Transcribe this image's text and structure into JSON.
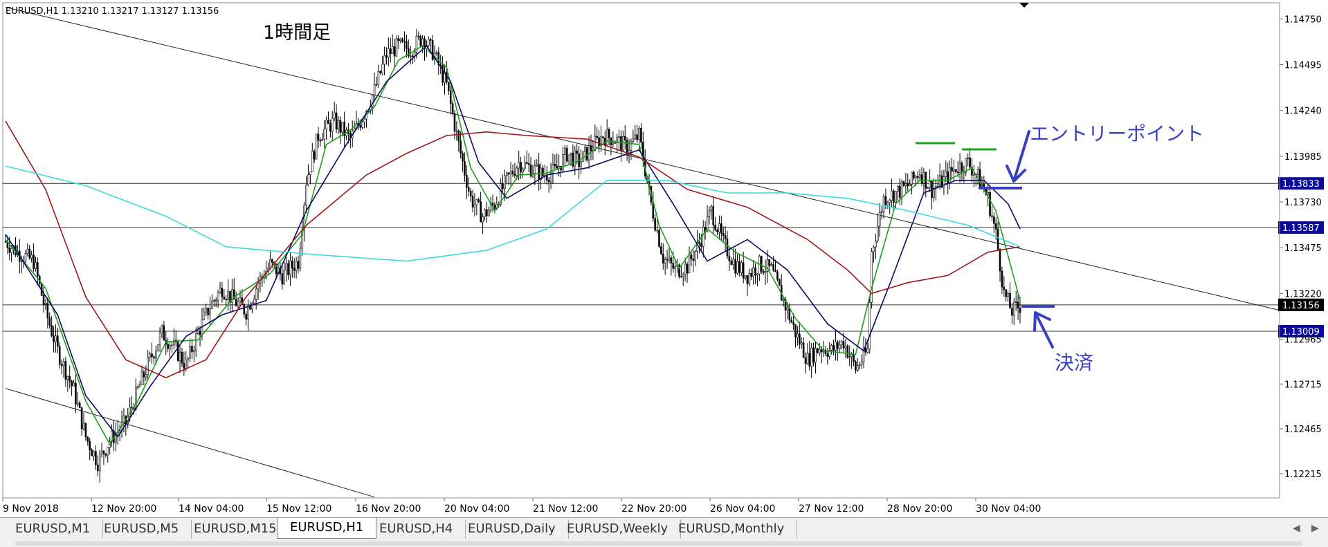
{
  "chart_data": {
    "type": "candlestick",
    "symbol_header": "EURUSD,H1  1.13210 1.13217 1.13127 1.13156",
    "title": "1時間足",
    "ylim": [
      1.1208,
      1.1484
    ],
    "y_ticks": [
      "1.14750",
      "1.14495",
      "1.14240",
      "1.13985",
      "1.13730",
      "1.13475",
      "1.13220",
      "1.12965",
      "1.12715",
      "1.12465",
      "1.12215"
    ],
    "x_tick_labels": [
      "9 Nov 2018",
      "12 Nov 20:00",
      "14 Nov 04:00",
      "15 Nov 12:00",
      "16 Nov 20:00",
      "20 Nov 04:00",
      "21 Nov 12:00",
      "22 Nov 20:00",
      "26 Nov 04:00",
      "27 Nov 12:00",
      "28 Nov 20:00",
      "30 Nov 04:00"
    ],
    "horizontal_levels": [
      {
        "value": 1.13833,
        "label": "1.13833",
        "color": "#0a0a9a"
      },
      {
        "value": 1.13587,
        "label": "1.13587",
        "color": "#0a0a9a"
      },
      {
        "value": 1.13156,
        "label": "1.13156",
        "color": "#000000"
      },
      {
        "value": 1.13009,
        "label": "1.13009",
        "color": "#0a0a9a"
      }
    ],
    "current_price": "1.13156",
    "close_path": [
      [
        0,
        1.1351
      ],
      [
        6,
        1.1345
      ],
      [
        14,
        1.134
      ],
      [
        20,
        1.1312
      ],
      [
        26,
        1.129
      ],
      [
        34,
        1.1268
      ],
      [
        40,
        1.1242
      ],
      [
        46,
        1.1228
      ],
      [
        52,
        1.124
      ],
      [
        60,
        1.125
      ],
      [
        66,
        1.1268
      ],
      [
        72,
        1.1285
      ],
      [
        78,
        1.13
      ],
      [
        84,
        1.1292
      ],
      [
        90,
        1.1282
      ],
      [
        96,
        1.13
      ],
      [
        102,
        1.1315
      ],
      [
        108,
        1.1325
      ],
      [
        114,
        1.1318
      ],
      [
        120,
        1.1312
      ],
      [
        126,
        1.1328
      ],
      [
        132,
        1.1338
      ],
      [
        138,
        1.1332
      ],
      [
        146,
        1.134
      ],
      [
        150,
        1.1385
      ],
      [
        156,
        1.141
      ],
      [
        164,
        1.1418
      ],
      [
        172,
        1.1408
      ],
      [
        178,
        1.142
      ],
      [
        184,
        1.1435
      ],
      [
        190,
        1.1455
      ],
      [
        196,
        1.146
      ],
      [
        202,
        1.1458
      ],
      [
        208,
        1.1465
      ],
      [
        214,
        1.1455
      ],
      [
        220,
        1.1438
      ],
      [
        226,
        1.1405
      ],
      [
        232,
        1.1375
      ],
      [
        238,
        1.1365
      ],
      [
        244,
        1.1372
      ],
      [
        250,
        1.1385
      ],
      [
        256,
        1.1395
      ],
      [
        262,
        1.1392
      ],
      [
        268,
        1.1388
      ],
      [
        274,
        1.139
      ],
      [
        280,
        1.14
      ],
      [
        286,
        1.1395
      ],
      [
        292,
        1.1403
      ],
      [
        298,
        1.141
      ],
      [
        304,
        1.1408
      ],
      [
        310,
        1.1403
      ],
      [
        316,
        1.141
      ],
      [
        322,
        1.1372
      ],
      [
        328,
        1.1342
      ],
      [
        334,
        1.1335
      ],
      [
        340,
        1.1337
      ],
      [
        346,
        1.135
      ],
      [
        352,
        1.1368
      ],
      [
        358,
        1.135
      ],
      [
        364,
        1.1338
      ],
      [
        370,
        1.1332
      ],
      [
        376,
        1.1338
      ],
      [
        382,
        1.1335
      ],
      [
        388,
        1.1318
      ],
      [
        394,
        1.13
      ],
      [
        400,
        1.1285
      ],
      [
        406,
        1.1292
      ],
      [
        412,
        1.129
      ],
      [
        418,
        1.1295
      ],
      [
        424,
        1.128
      ],
      [
        430,
        1.129
      ],
      [
        432,
        1.1345
      ],
      [
        438,
        1.1375
      ],
      [
        444,
        1.1378
      ],
      [
        450,
        1.1382
      ],
      [
        456,
        1.139
      ],
      [
        462,
        1.138
      ],
      [
        468,
        1.1385
      ],
      [
        474,
        1.1392
      ],
      [
        480,
        1.1395
      ],
      [
        486,
        1.1385
      ],
      [
        490,
        1.1375
      ],
      [
        494,
        1.1355
      ],
      [
        498,
        1.1322
      ],
      [
        502,
        1.1312
      ],
      [
        506,
        1.1315
      ]
    ],
    "series": [
      {
        "name": "",
        "color": "#1aa01a",
        "values": [
          [
            0,
            1.1352
          ],
          [
            20,
            1.1325
          ],
          [
            40,
            1.1262
          ],
          [
            52,
            1.1238
          ],
          [
            66,
            1.1262
          ],
          [
            80,
            1.1295
          ],
          [
            96,
            1.1296
          ],
          [
            114,
            1.132
          ],
          [
            132,
            1.1333
          ],
          [
            148,
            1.1355
          ],
          [
            160,
            1.1405
          ],
          [
            172,
            1.1413
          ],
          [
            184,
            1.1426
          ],
          [
            196,
            1.1452
          ],
          [
            208,
            1.146
          ],
          [
            220,
            1.1448
          ],
          [
            232,
            1.1392
          ],
          [
            244,
            1.1368
          ],
          [
            256,
            1.1388
          ],
          [
            270,
            1.1389
          ],
          [
            286,
            1.1396
          ],
          [
            300,
            1.1407
          ],
          [
            316,
            1.1405
          ],
          [
            326,
            1.136
          ],
          [
            336,
            1.1336
          ],
          [
            350,
            1.1358
          ],
          [
            364,
            1.1345
          ],
          [
            380,
            1.1336
          ],
          [
            394,
            1.1308
          ],
          [
            408,
            1.129
          ],
          [
            424,
            1.1288
          ],
          [
            432,
            1.1325
          ],
          [
            444,
            1.1372
          ],
          [
            456,
            1.1385
          ],
          [
            470,
            1.1385
          ],
          [
            482,
            1.1392
          ],
          [
            494,
            1.1368
          ],
          [
            506,
            1.1318
          ]
        ]
      },
      {
        "name": "",
        "color": "#0a0a60",
        "values": [
          [
            0,
            1.1355
          ],
          [
            26,
            1.131
          ],
          [
            40,
            1.1265
          ],
          [
            56,
            1.1242
          ],
          [
            72,
            1.127
          ],
          [
            90,
            1.1298
          ],
          [
            108,
            1.131
          ],
          [
            130,
            1.1318
          ],
          [
            150,
            1.1368
          ],
          [
            170,
            1.1405
          ],
          [
            190,
            1.144
          ],
          [
            210,
            1.146
          ],
          [
            222,
            1.144
          ],
          [
            236,
            1.1395
          ],
          [
            250,
            1.1375
          ],
          [
            270,
            1.1388
          ],
          [
            290,
            1.1392
          ],
          [
            316,
            1.1402
          ],
          [
            334,
            1.137
          ],
          [
            350,
            1.134
          ],
          [
            370,
            1.1352
          ],
          [
            390,
            1.1335
          ],
          [
            410,
            1.1305
          ],
          [
            428,
            1.129
          ],
          [
            442,
            1.133
          ],
          [
            458,
            1.1378
          ],
          [
            474,
            1.1385
          ],
          [
            488,
            1.1385
          ],
          [
            500,
            1.1372
          ],
          [
            506,
            1.1358
          ]
        ]
      },
      {
        "name": "",
        "color": "#a01818",
        "values": [
          [
            0,
            1.1418
          ],
          [
            20,
            1.138
          ],
          [
            40,
            1.132
          ],
          [
            60,
            1.1285
          ],
          [
            80,
            1.1275
          ],
          [
            100,
            1.1285
          ],
          [
            120,
            1.132
          ],
          [
            150,
            1.136
          ],
          [
            180,
            1.1388
          ],
          [
            200,
            1.14
          ],
          [
            220,
            1.141
          ],
          [
            240,
            1.1412
          ],
          [
            260,
            1.141
          ],
          [
            290,
            1.1408
          ],
          [
            316,
            1.1398
          ],
          [
            340,
            1.138
          ],
          [
            370,
            1.137
          ],
          [
            400,
            1.1352
          ],
          [
            420,
            1.1335
          ],
          [
            432,
            1.1322
          ],
          [
            450,
            1.1328
          ],
          [
            470,
            1.1332
          ],
          [
            490,
            1.1345
          ],
          [
            506,
            1.1348
          ]
        ]
      },
      {
        "name": "",
        "color": "#3fd8e0",
        "values": [
          [
            0,
            1.1393
          ],
          [
            40,
            1.1382
          ],
          [
            80,
            1.1365
          ],
          [
            110,
            1.1348
          ],
          [
            150,
            1.1344
          ],
          [
            200,
            1.134
          ],
          [
            240,
            1.1346
          ],
          [
            270,
            1.1358
          ],
          [
            300,
            1.1385
          ],
          [
            330,
            1.1385
          ],
          [
            360,
            1.1378
          ],
          [
            390,
            1.1378
          ],
          [
            420,
            1.1375
          ],
          [
            450,
            1.1368
          ],
          [
            480,
            1.136
          ],
          [
            506,
            1.1348
          ]
        ]
      }
    ],
    "trendlines": [
      {
        "from": [
          0,
          1.14815
        ],
        "to": [
          506,
          1.1347
        ],
        "color": "#222222"
      },
      {
        "from": [
          0,
          1.1269
        ],
        "to": [
          184,
          1.12085
        ],
        "color": "#222222"
      }
    ],
    "annotations": [
      {
        "text": "エントリーポイント",
        "color": "#3a40c0"
      },
      {
        "text": "決済",
        "color": "#3a40c0"
      }
    ]
  },
  "tabs": [
    {
      "label": "EURUSD,M1",
      "active": false
    },
    {
      "label": "EURUSD,M5",
      "active": false
    },
    {
      "label": "EURUSD,M15",
      "active": false
    },
    {
      "label": "EURUSD,H1",
      "active": true
    },
    {
      "label": "EURUSD,H4",
      "active": false
    },
    {
      "label": "EURUSD,Daily",
      "active": false
    },
    {
      "label": "EURUSD,Weekly",
      "active": false
    },
    {
      "label": "EURUSD,Monthly",
      "active": false
    }
  ]
}
